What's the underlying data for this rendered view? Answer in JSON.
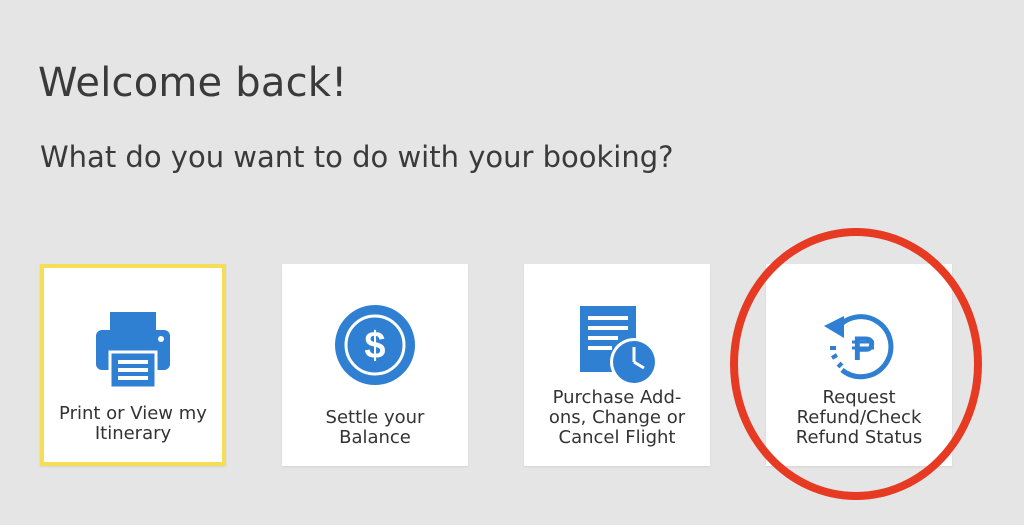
{
  "header": {
    "title": "Welcome back!",
    "subtitle": "What do you want to do with your booking?"
  },
  "colors": {
    "accent_blue": "#2f7fd3",
    "selected_border": "#f5de55",
    "highlight_ring": "#e63a22",
    "background": "#e5e5e5"
  },
  "options": [
    {
      "label": "Print or View my\nItinerary",
      "icon": "printer-icon",
      "selected": true
    },
    {
      "label": "Settle your\nBalance",
      "icon": "dollar-coin-icon",
      "selected": false
    },
    {
      "label": "Purchase Add-\nons, Change or\nCancel Flight",
      "icon": "document-clock-icon",
      "selected": false
    },
    {
      "label": "Request\nRefund/Check\nRefund Status",
      "icon": "refund-peso-icon",
      "selected": false,
      "highlighted": true
    }
  ]
}
